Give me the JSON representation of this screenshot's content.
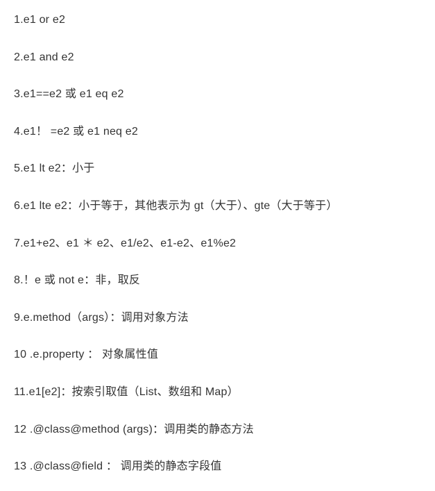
{
  "items": [
    "1.e1 or e2",
    "2.e1 and e2",
    "3.e1==e2 或 e1 eq e2",
    "4.e1！ =e2 或 e1 neq e2",
    "5.e1 lt e2：小于",
    "6.e1 lte e2：小于等于，其他表示为 gt（大于）、gte（大于等于）",
    "7.e1+e2、e1 ＊ e2、e1/e2、e1-e2、e1%e2",
    "8.！e 或 not e：非，取反",
    "9.e.method（args）：调用对象方法",
    "10 .e.property ： 对象属性值",
    "11.e1[e2]：按索引取值（List、数组和 Map）",
    "12 .@class@method (args)：调用类的静态方法",
    "13 .@class@field ： 调用类的静态字段值"
  ]
}
